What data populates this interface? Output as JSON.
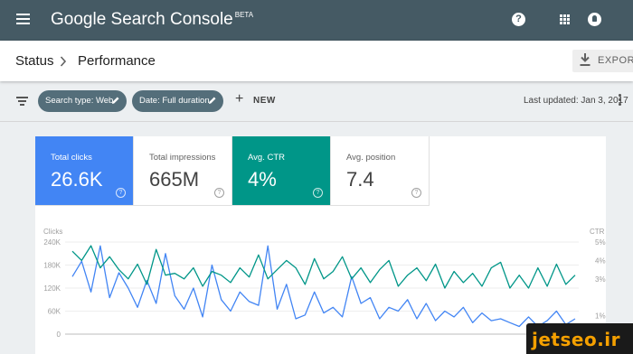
{
  "header": {
    "app_title": "Google Search Console",
    "beta_tag": "BETA",
    "menu_icon": "menu-icon",
    "help_icon": "help-icon",
    "apps_icon": "apps-grid-icon",
    "notifications_icon": "bell-icon",
    "help_glyph": "?",
    "bg_color": "#455a64"
  },
  "breadcrumb": {
    "parent": "Status",
    "current": "Performance",
    "separator_icon": "chevron-right-icon"
  },
  "toolbar": {
    "export_label": "EXPORT",
    "export_icon": "download-icon"
  },
  "filters": {
    "filter_icon": "filter-icon",
    "chips": [
      {
        "label": "Search type: Web",
        "icon": "edit-icon"
      },
      {
        "label": "Date: Full duration",
        "icon": "edit-icon"
      }
    ],
    "new_label": "NEW",
    "new_glyph": "+",
    "last_updated": "Last updated: Jan 3, 2017",
    "more_icon": "more-vert-icon"
  },
  "metrics": [
    {
      "title": "Total clicks",
      "value": "26.6K",
      "selected": true,
      "color": "#4285f4"
    },
    {
      "title": "Total impressions",
      "value": "665M",
      "selected": false,
      "color": "#ffffff"
    },
    {
      "title": "Avg. CTR",
      "value": "4%",
      "selected": true,
      "color": "#009688"
    },
    {
      "title": "Avg. position",
      "value": "7.4",
      "selected": false,
      "color": "#ffffff"
    }
  ],
  "metric_help_glyph": "?",
  "chart_data": {
    "type": "line",
    "left_axis_label": "Clicks",
    "right_axis_label": "CTR",
    "left_ticks": [
      "240K",
      "180K",
      "120K",
      "60K",
      "0"
    ],
    "right_ticks": [
      "5%",
      "4%",
      "3%",
      "1%"
    ],
    "left_ylim": [
      0,
      240000
    ],
    "right_ylim": [
      0,
      5
    ],
    "grid": true,
    "series": [
      {
        "axis": "left",
        "color": "#4285f4",
        "values": [
          150000,
          190000,
          110000,
          230000,
          95000,
          160000,
          120000,
          70000,
          140000,
          80000,
          210000,
          100000,
          65000,
          120000,
          45000,
          180000,
          90000,
          60000,
          110000,
          85000,
          75000,
          230000,
          65000,
          130000,
          40000,
          50000,
          110000,
          55000,
          70000,
          45000,
          150000,
          80000,
          95000,
          40000,
          70000,
          60000,
          90000,
          40000,
          80000,
          35000,
          60000,
          45000,
          70000,
          30000,
          55000,
          35000,
          40000,
          30000,
          20000,
          45000,
          20000,
          35000,
          60000,
          25000,
          40000
        ]
      },
      {
        "axis": "right",
        "color": "#009688",
        "values": [
          4.5,
          4.0,
          4.8,
          3.6,
          4.2,
          3.5,
          3.0,
          3.8,
          2.7,
          4.6,
          3.2,
          3.3,
          3.0,
          3.6,
          2.6,
          3.4,
          3.2,
          2.8,
          3.6,
          3.1,
          4.3,
          3.0,
          3.5,
          4.0,
          3.6,
          2.7,
          4.1,
          3.0,
          3.4,
          4.2,
          3.0,
          3.6,
          2.8,
          3.5,
          4.0,
          2.6,
          3.2,
          3.6,
          2.9,
          3.8,
          2.5,
          3.4,
          2.8,
          3.3,
          2.6,
          3.6,
          3.9,
          2.5,
          3.2,
          2.5,
          3.6,
          2.6,
          3.8,
          2.7,
          3.2
        ]
      }
    ]
  },
  "watermark": {
    "text": "jetseo.ir"
  }
}
